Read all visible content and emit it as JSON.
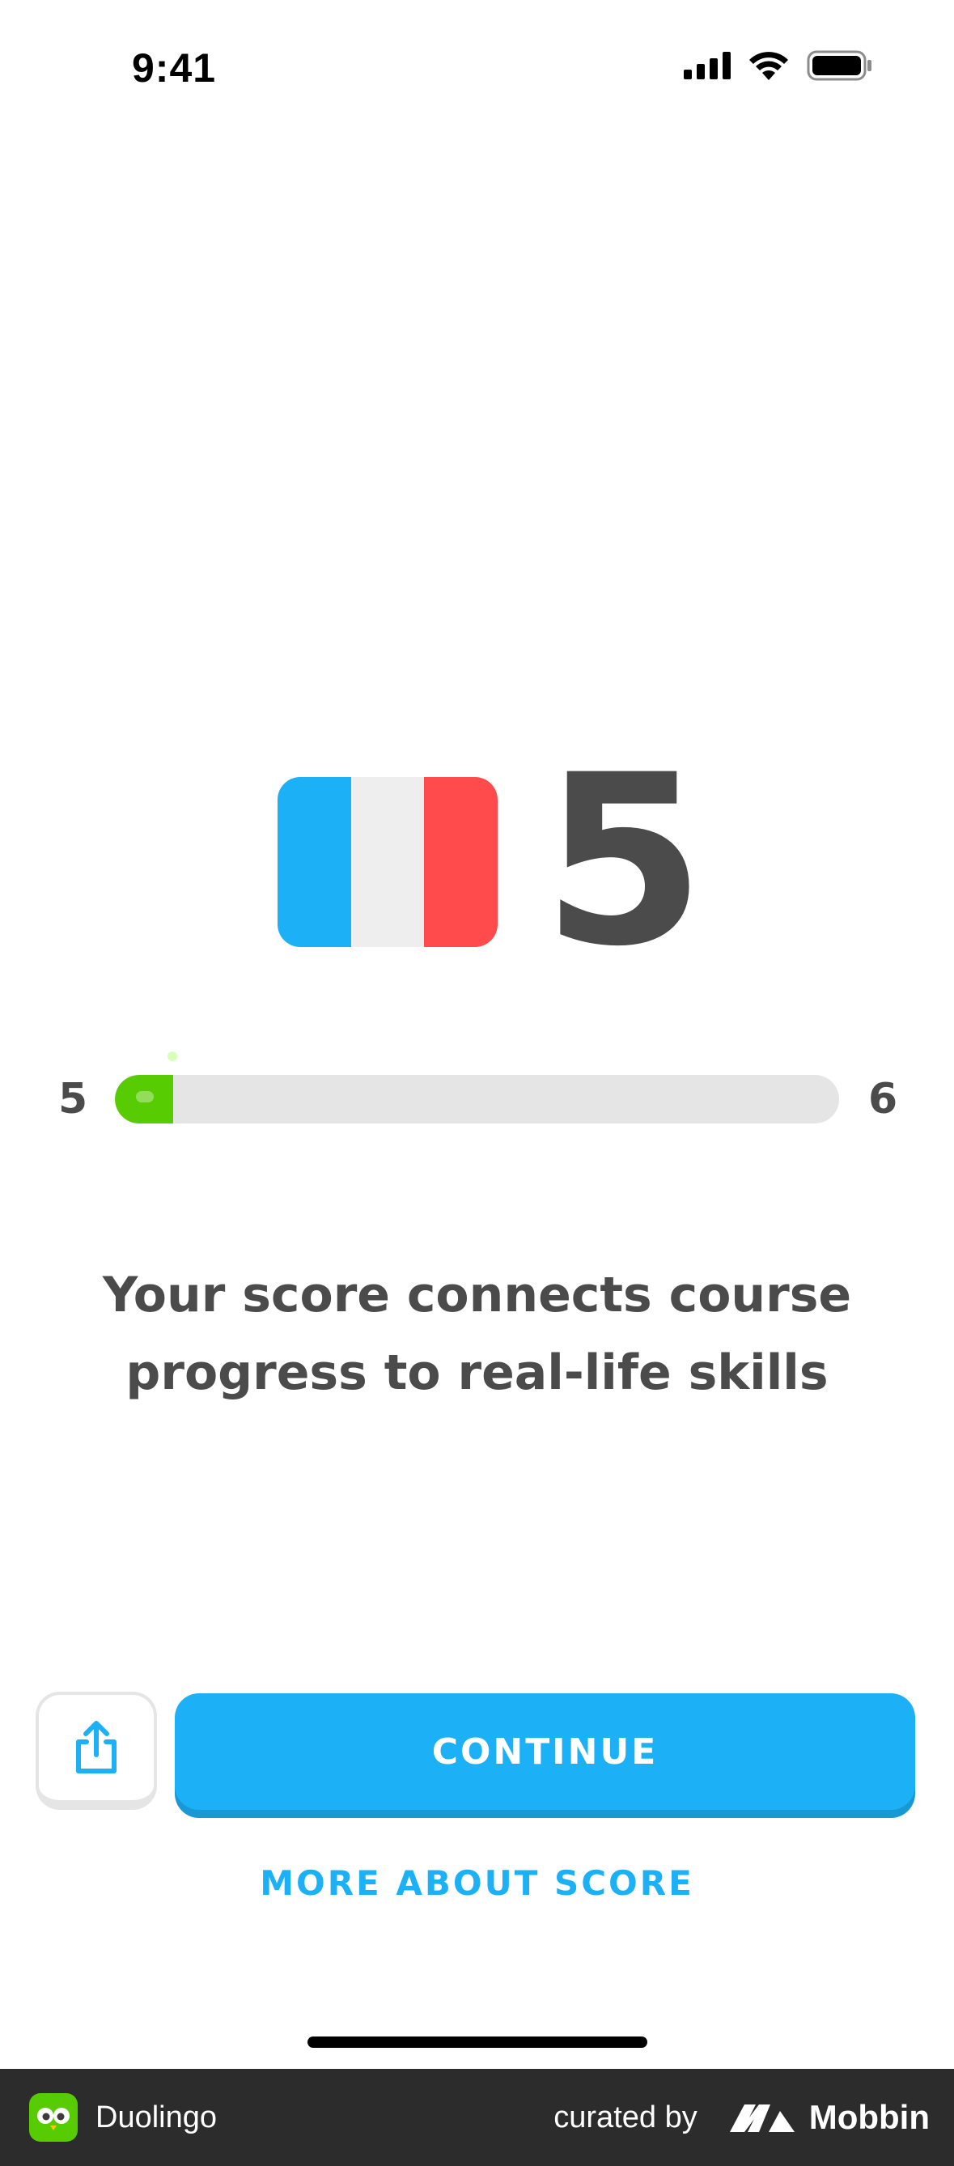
{
  "status_bar": {
    "time": "9:41"
  },
  "score": {
    "value": "5",
    "flag_colors": [
      "#1cb0f6",
      "#eeeeee",
      "#ff4b4b"
    ]
  },
  "progress": {
    "from_level": "5",
    "to_level": "6",
    "fraction": 0.08,
    "fill_color": "#58cc02"
  },
  "message": "Your score connects course progress to real-life skills",
  "actions": {
    "share_icon": "share-icon",
    "continue_label": "CONTINUE",
    "more_label": "MORE ABOUT SCORE"
  },
  "footer": {
    "app_name": "Duolingo",
    "curated_label": "curated by",
    "brand": "Mobbin"
  }
}
